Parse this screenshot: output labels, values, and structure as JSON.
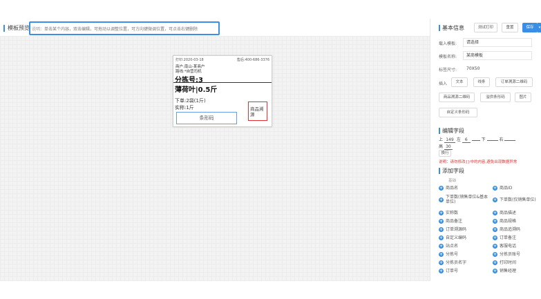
{
  "header": {
    "title": "模板预览",
    "hint_label": "说明：",
    "hint_text": "单击某个内容，双击编辑，可拖动以调整位置，可方向键微调位置，可点击右键删除"
  },
  "label": {
    "print_time": "打印:2020-03-18",
    "hotline": "售后:400-686-3376",
    "customer": "商户:南山-某商户",
    "road": "路线:*自营司机",
    "sort_no": "分拣号:3",
    "product": "薄荷叶|0.5斤",
    "order_qty": "下单:2袋(1斤)",
    "actual": "实称:1斤",
    "barcode": "条形码",
    "qr": "商品溯源"
  },
  "panel": {
    "basic_info_title": "基本信息",
    "buttons": {
      "test_print": "测试打印",
      "reset": "重置",
      "save": "保存"
    },
    "load_template_label": "载入模板:",
    "load_template_value": "请选择",
    "template_name_label": "模板名称:",
    "template_name_value": "某商模板",
    "paper_size_label": "标签尺寸:",
    "paper_size_value": "70X50",
    "insert_label": "插入",
    "insert_items": [
      "文本",
      "线条",
      "订单溯源二维码",
      "商品溯源二维码",
      "溢供条形码",
      "图片",
      "自定义条形码"
    ],
    "edit_title": "编辑字段",
    "edit": {
      "top_label": "上",
      "top_value": "149",
      "left_label": "左",
      "left_value": "6",
      "bottom_label": "下",
      "right_label": "右",
      "height_label": "高",
      "height_value": "30",
      "wrap": "换行"
    },
    "warning": "说明：请勿修改{}中的内容,避免出现数据异常",
    "add_title": "添加字段",
    "basic_group": "基础",
    "fields": [
      [
        "商品名",
        "商品ID"
      ],
      [
        "下单数(销售单位&基本单位)",
        "下单数(仅销售单位)"
      ],
      [
        "实称数",
        "商品描述"
      ],
      [
        "商品备注",
        "商品规格"
      ],
      [
        "订单溯源码",
        "商品追溯码"
      ],
      [
        "自定义编码",
        "订单备注"
      ],
      [
        "站点名",
        "客服电话"
      ],
      [
        "分拣号",
        "分拣员账号"
      ],
      [
        "分拣员名字",
        "打印时间"
      ],
      [
        "订单号",
        "销售经理"
      ]
    ]
  }
}
